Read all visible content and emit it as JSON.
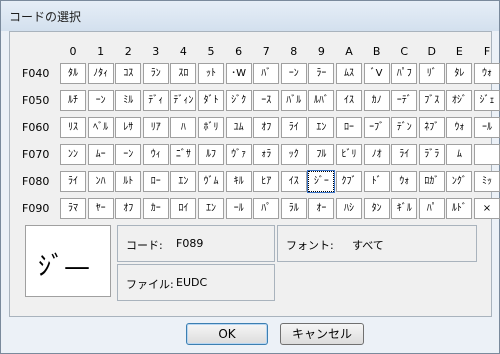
{
  "window": {
    "title": "コードの選択"
  },
  "grid": {
    "col_headers": [
      "0",
      "1",
      "2",
      "3",
      "4",
      "5",
      "6",
      "7",
      "8",
      "9",
      "A",
      "B",
      "C",
      "D",
      "E",
      "F"
    ],
    "rows": [
      {
        "label": "F040",
        "cells": [
          "ﾀﾙ",
          "ﾉﾀｨ",
          "ｺｽ",
          "ﾗﾝ",
          "ｽﾛ",
          "ｯﾄ",
          "･W",
          "ﾊﾞ",
          "ｰﾝ",
          "ﾗｰ",
          "ﾑｽ",
          "ﾞV",
          "ﾊﾟﾌ",
          "ﾘﾞ",
          "ﾀﾚ",
          "ｳｫ"
        ]
      },
      {
        "label": "F050",
        "cells": [
          "ﾙﾁ",
          "ｰﾝ",
          "ﾐﾙ",
          "ﾃﾞｨ",
          "ﾃﾞｨﾝ",
          "ﾀﾞﾄ",
          "ｼﾞｸ",
          "ｰｽ",
          "ﾊﾞﾙ",
          "ﾙﾊﾞ",
          "ｲｽ",
          "ｶﾉ",
          "ｰﾃﾞ",
          "ﾌﾞｽ",
          "ｵｼﾞ",
          "ｼﾞｪ"
        ]
      },
      {
        "label": "F060",
        "cells": [
          "ﾘｽ",
          "ﾍﾞﾙ",
          "ﾚｻ",
          "ﾘｱ",
          "ﾊ",
          "ﾎﾞﾘ",
          "ﾕﾑ",
          "ｵﾌ",
          "ﾗｲ",
          "ｴﾝ",
          "ﾛｰ",
          "ｰﾌﾞ",
          "ﾃﾞﾝ",
          "ﾈﾌﾞ",
          "ｳｫ",
          "ｰﾙ"
        ]
      },
      {
        "label": "F070",
        "cells": [
          "ﾝﾝ",
          "ﾑｰ",
          "ｰﾝ",
          "ｳｨ",
          "ﾆﾞｻ",
          "ﾙﾌ",
          "ｳﾞｧ",
          "ｫﾗ",
          "ｯｸ",
          "ﾌﾙ",
          "ﾋﾞﾘ",
          "ﾉｵ",
          "ﾗｲ",
          "ﾗﾞﾗ",
          "ﾑ",
          ""
        ]
      },
      {
        "label": "F080",
        "cells": [
          "ﾗｲ",
          "ﾝﾊ",
          "ﾙﾄ",
          "ﾛｰ",
          "ｴﾝ",
          "ｳﾞﾑ",
          "ｷﾙ",
          "ﾋｱ",
          "ｲｽ",
          "ｼﾞｰ",
          "ｸﾌﾞ",
          "ﾄﾞ",
          "ｳｫ",
          "ﾛｶﾞ",
          "ﾝｸﾞ",
          "ﾐｯ"
        ]
      },
      {
        "label": "F090",
        "cells": [
          "ﾗﾏ",
          "ﾔｰ",
          "ｵﾌ",
          "ｶｰ",
          "ﾛｲ",
          "ｴﾝ",
          "ｰﾙ",
          "ﾊﾟ",
          "ﾗﾙ",
          "ｵｰ",
          "ﾊｼ",
          "ﾀﾝ",
          "ｷﾞﾙ",
          "ﾊﾟ",
          "ﾙﾄﾞ",
          "×"
        ]
      }
    ]
  },
  "preview": {
    "glyph": "ｼﾞ—"
  },
  "info": {
    "code_label": "コード:",
    "code_value": "F089",
    "font_label": "フォント:",
    "font_value": "すべて",
    "file_label": "ファイル:",
    "file_value": "EUDC"
  },
  "buttons": {
    "ok": "OK",
    "cancel": "キャンセル"
  }
}
